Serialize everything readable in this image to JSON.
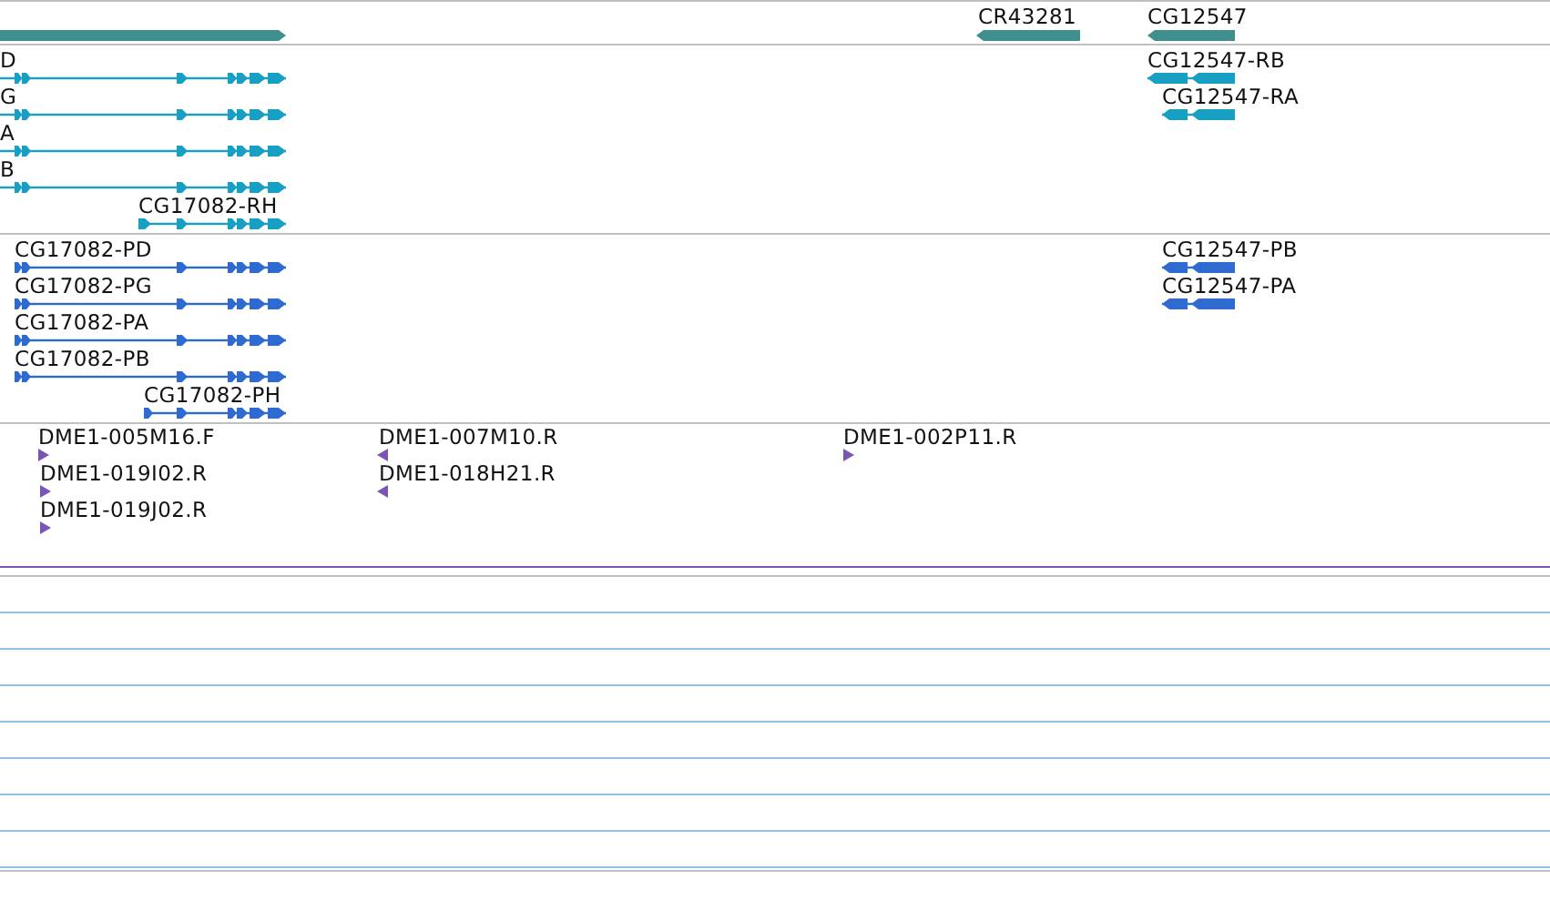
{
  "tracks": [
    {
      "kind": "gene",
      "features": [
        {
          "reverse": false
        },
        {
          "label": "CR43281",
          "reverse": true
        },
        {
          "label": "CG12547",
          "reverse": true
        }
      ]
    },
    {
      "kind": "transcript",
      "features": [
        {
          "label": "D",
          "reverse": false
        },
        {
          "label": "G",
          "reverse": false
        },
        {
          "label": "A",
          "reverse": false
        },
        {
          "label": "B",
          "reverse": false
        },
        {
          "label": "CG17082-RH",
          "reverse": false
        },
        {
          "label": "CG12547-RB",
          "reverse": true
        },
        {
          "label": "CG12547-RA",
          "reverse": true
        }
      ]
    },
    {
      "kind": "cds",
      "features": [
        {
          "label": "CG17082-PD",
          "reverse": false
        },
        {
          "label": "CG17082-PG",
          "reverse": false
        },
        {
          "label": "CG17082-PA",
          "reverse": false
        },
        {
          "label": "CG17082-PB",
          "reverse": false
        },
        {
          "label": "CG17082-PH",
          "reverse": false
        },
        {
          "label": "CG12547-PB",
          "reverse": true
        },
        {
          "label": "CG12547-PA",
          "reverse": true
        }
      ]
    },
    {
      "kind": "clone",
      "features": [
        {
          "label": "DME1-005M16.F",
          "reverse": false
        },
        {
          "label": "DME1-019I02.R",
          "reverse": false
        },
        {
          "label": "DME1-019J02.R",
          "reverse": false
        },
        {
          "label": "DME1-007M10.R",
          "reverse": true
        },
        {
          "label": "DME1-018H21.R",
          "reverse": true
        },
        {
          "label": "DME1-002P11.R",
          "reverse": false
        }
      ]
    }
  ]
}
